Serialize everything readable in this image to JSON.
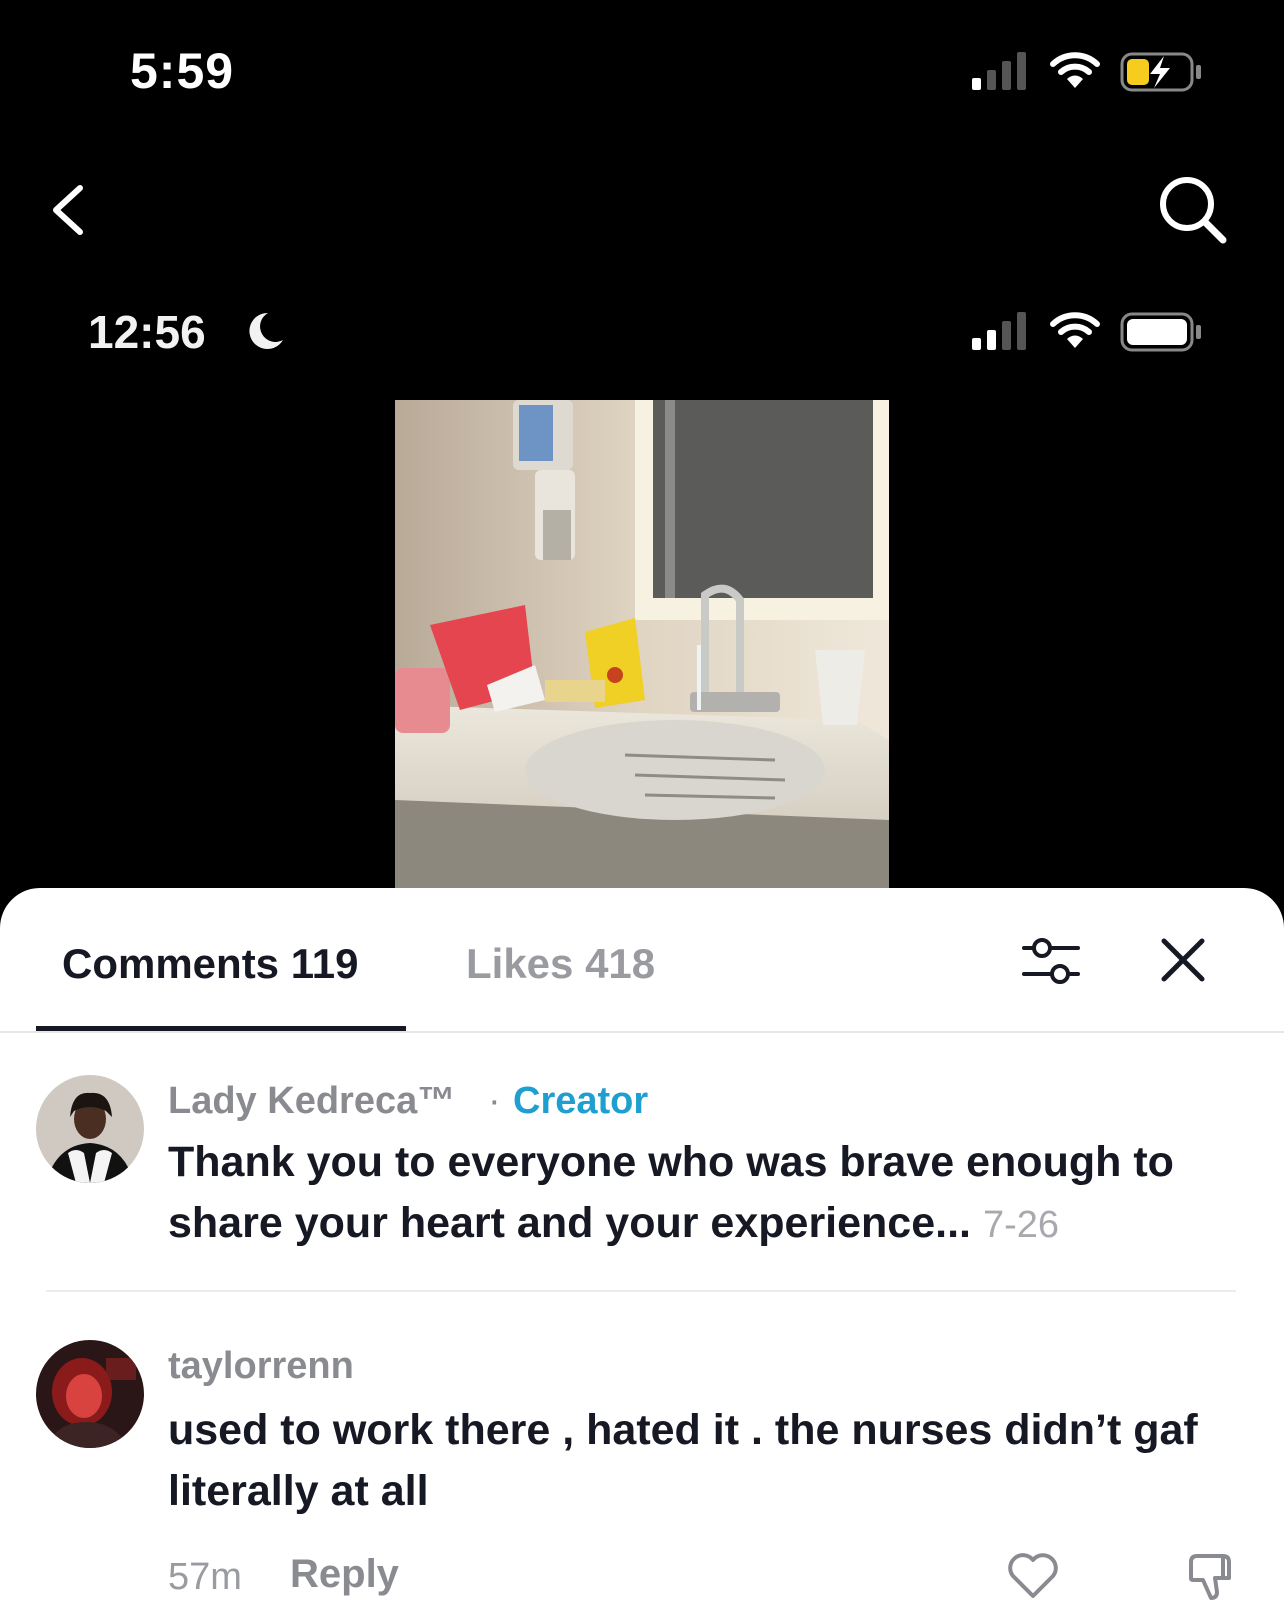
{
  "outer_status_bar": {
    "time": "5:59",
    "battery_charging": true
  },
  "inner_status_bar": {
    "time": "12:56"
  },
  "tabs": {
    "comments_label": "Comments",
    "comments_count": "119",
    "likes_label": "Likes",
    "likes_count": "418"
  },
  "comments": [
    {
      "username": "Lady Kedreca™",
      "separator": "·",
      "badge": "Creator",
      "text": "Thank you to everyone who was brave enough to share your heart and your experience...",
      "date": "7-26"
    },
    {
      "username": "taylorrenn",
      "text": "used to work there , hated it . the nurses didn’t gaf literally at all",
      "time": "57m",
      "reply_label": "Reply"
    }
  ],
  "colors": {
    "creator_badge": "#1f9fd0",
    "battery_fill": "#f6cd1f",
    "primary_text": "#161823",
    "muted_text": "#8a8b91"
  },
  "icons": [
    "back-icon",
    "search-icon",
    "moon-icon",
    "filter-icon",
    "close-icon",
    "heart-icon",
    "dislike-icon"
  ]
}
